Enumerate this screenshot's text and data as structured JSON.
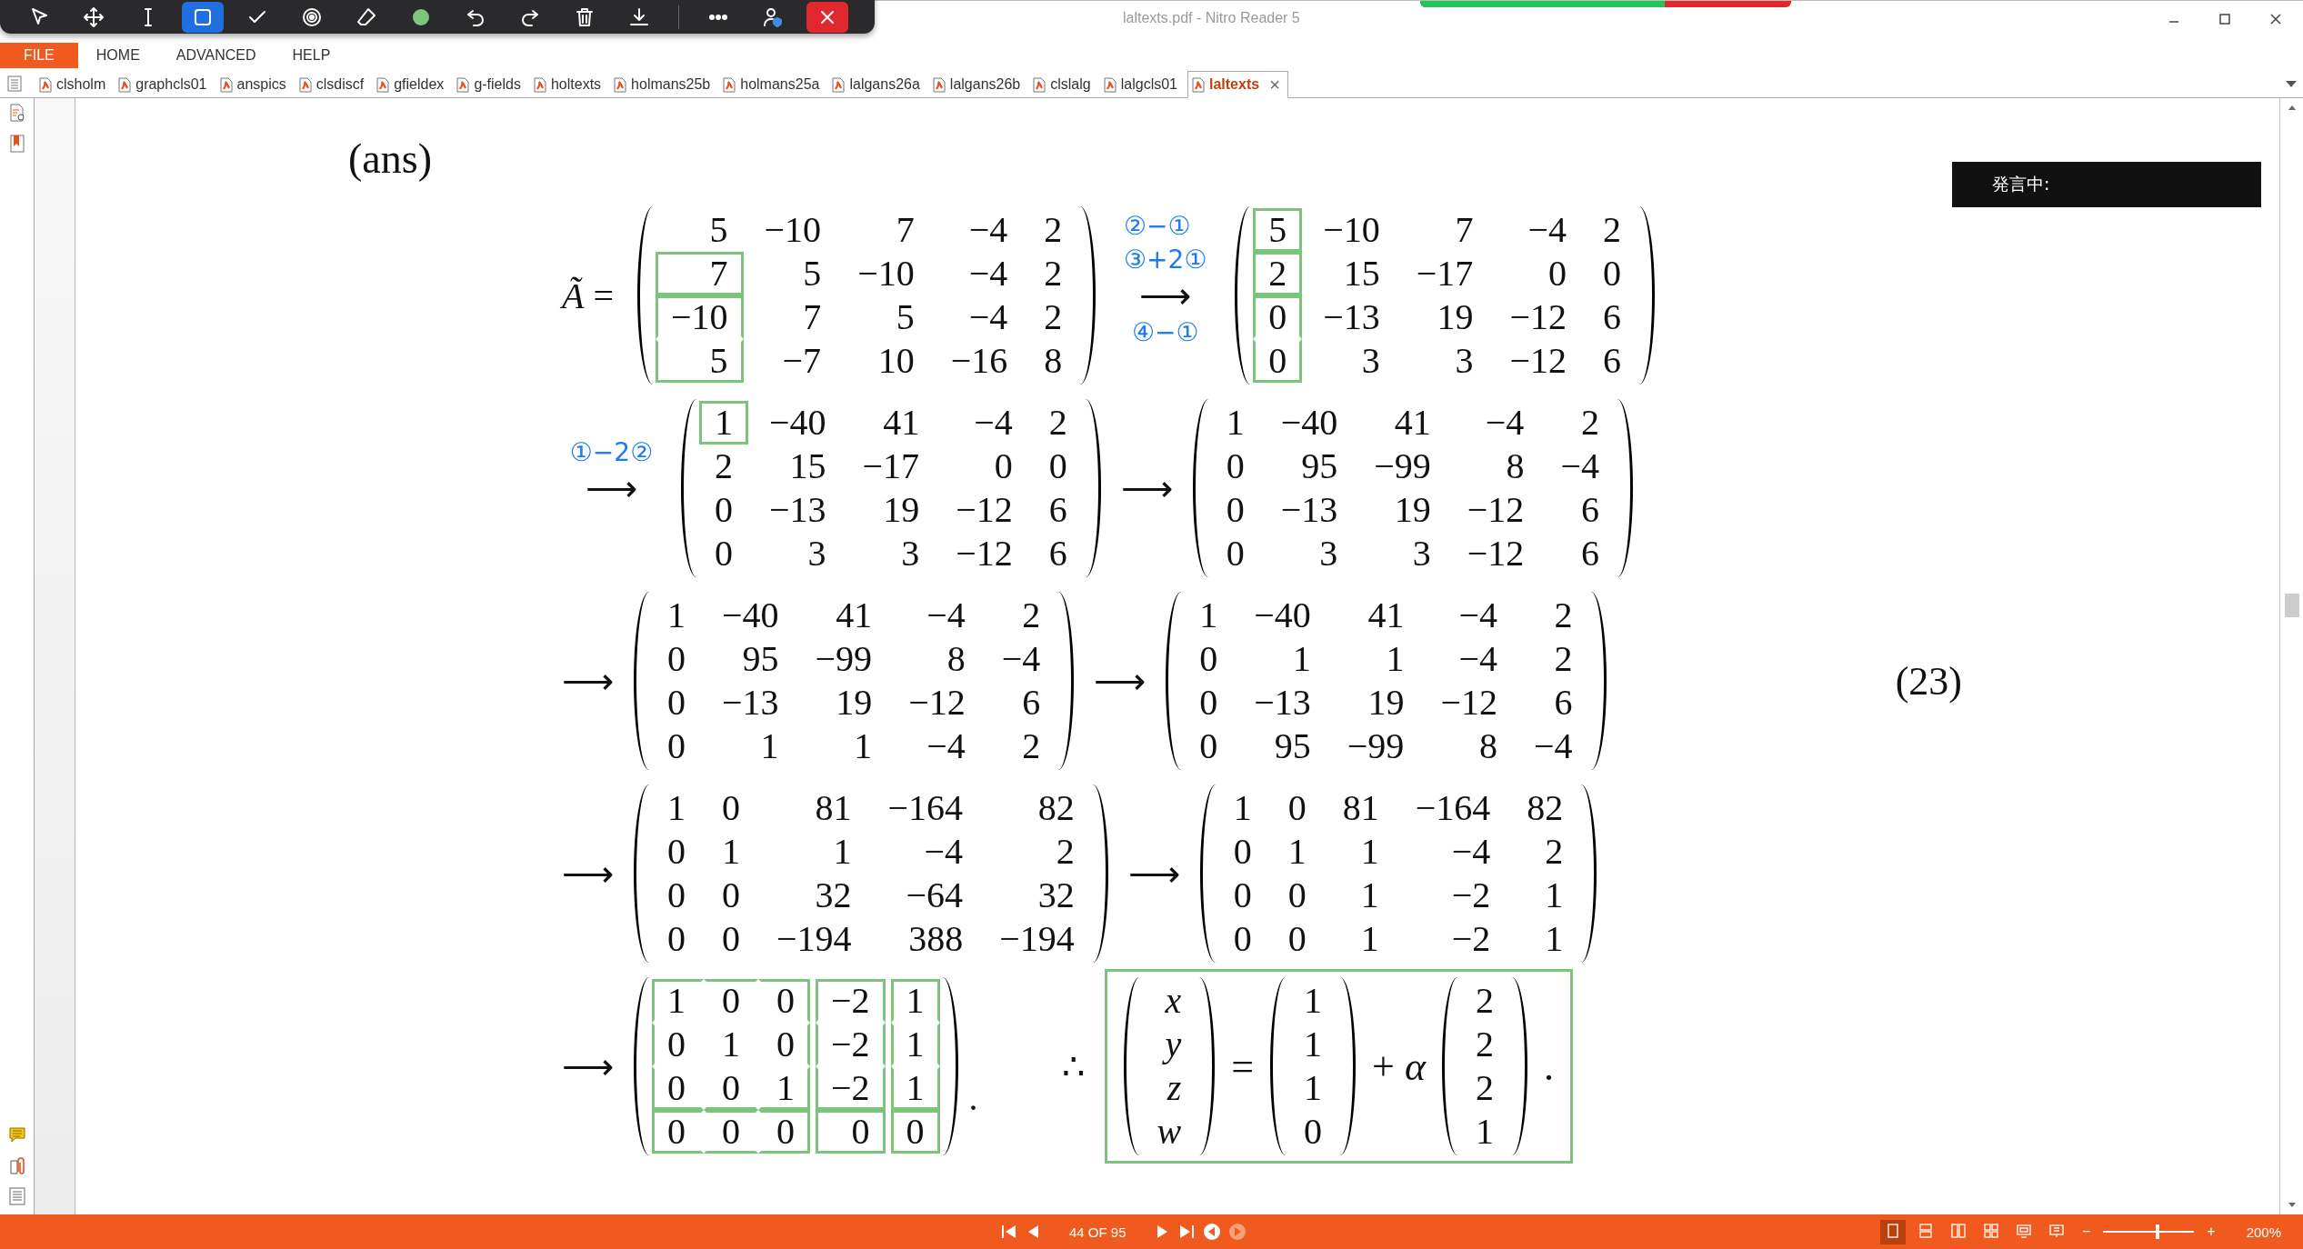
{
  "window": {
    "title": "laltexts.pdf - Nitro Reader 5"
  },
  "meter": {
    "level": 0.66
  },
  "toolbar": [
    {
      "kind": "pointer",
      "selected": false
    },
    {
      "kind": "move",
      "selected": false
    },
    {
      "kind": "text",
      "selected": false
    },
    {
      "kind": "rectangle",
      "selected": true
    },
    {
      "kind": "check",
      "selected": false
    },
    {
      "kind": "record",
      "selected": false
    },
    {
      "kind": "eraser",
      "selected": false
    },
    {
      "kind": "color",
      "selected": false
    },
    {
      "kind": "undo",
      "selected": false
    },
    {
      "kind": "redo",
      "selected": false
    },
    {
      "kind": "delete",
      "selected": false
    },
    {
      "kind": "download",
      "selected": false
    },
    {
      "kind": "more",
      "selected": false
    },
    {
      "kind": "user",
      "selected": false
    },
    {
      "kind": "close",
      "selected": false
    }
  ],
  "menu": [
    {
      "label": "FILE",
      "selected": true
    },
    {
      "label": "HOME",
      "selected": false
    },
    {
      "label": "ADVANCED",
      "selected": false
    },
    {
      "label": "HELP",
      "selected": false
    }
  ],
  "tabs": [
    {
      "label": "clsholm",
      "selected": false
    },
    {
      "label": "graphcls01",
      "selected": false
    },
    {
      "label": "anspics",
      "selected": false
    },
    {
      "label": "clsdiscf",
      "selected": false
    },
    {
      "label": "gfieldex",
      "selected": false
    },
    {
      "label": "g-fields",
      "selected": false
    },
    {
      "label": "holtexts",
      "selected": false
    },
    {
      "label": "holmans25b",
      "selected": false
    },
    {
      "label": "holmans25a",
      "selected": false
    },
    {
      "label": "lalgans26a",
      "selected": false
    },
    {
      "label": "lalgans26b",
      "selected": false
    },
    {
      "label": "clslalg",
      "selected": false
    },
    {
      "label": "lalgcls01",
      "selected": false
    },
    {
      "label": "laltexts",
      "selected": true,
      "close": "×"
    }
  ],
  "popup": {
    "text": "発言中:"
  },
  "document": {
    "heading": "(ans)",
    "rows": [
      {
        "items": [
          {
            "kind": "label",
            "text": "*Ã* ="
          },
          {
            "kind": "matrix",
            "rows": [
              [
                "5",
                "−10",
                "7",
                "−4",
                "2"
              ],
              [
                {
                  "t": "7",
                  "boxed": true
                },
                "5",
                "−10",
                "−4",
                "2"
              ],
              [
                {
                  "t": "−10",
                  "boxed": true,
                  "merge_down": true
                },
                "7",
                "5",
                "−4",
                "2"
              ],
              [
                {
                  "t": "5",
                  "boxed": true
                },
                "−7",
                "10",
                "−16",
                "8"
              ]
            ]
          },
          {
            "kind": "arrow",
            "text": "⟶",
            "notes_above": [
              "②−①",
              "③+2①"
            ],
            "notes_below": [
              "④−①"
            ]
          },
          {
            "kind": "matrix",
            "rows": [
              [
                {
                  "t": "5",
                  "boxed": true
                },
                "−10",
                "7",
                "−4",
                "2"
              ],
              [
                {
                  "t": "2",
                  "boxed": true
                },
                "15",
                "−17",
                "0",
                "0"
              ],
              [
                {
                  "t": "0",
                  "boxed": true,
                  "merge_down": true
                },
                "−13",
                "19",
                "−12",
                "6"
              ],
              [
                {
                  "t": "0",
                  "boxed": true
                },
                "3",
                "3",
                "−12",
                "6"
              ]
            ]
          }
        ]
      },
      {
        "items": [
          {
            "kind": "arrow",
            "text": "⟶",
            "notes_above": [
              "①−2②"
            ]
          },
          {
            "kind": "matrix",
            "rows": [
              [
                {
                  "t": "1",
                  "boxed": true
                },
                "−40",
                "41",
                "−4",
                "2"
              ],
              [
                "2",
                "15",
                "−17",
                "0",
                "0"
              ],
              [
                "0",
                "−13",
                "19",
                "−12",
                "6"
              ],
              [
                "0",
                "3",
                "3",
                "−12",
                "6"
              ]
            ]
          },
          {
            "kind": "arrow",
            "text": "⟶"
          },
          {
            "kind": "matrix",
            "rows": [
              [
                "1",
                "−40",
                "41",
                "−4",
                "2"
              ],
              [
                "0",
                "95",
                "−99",
                "8",
                "−4"
              ],
              [
                "0",
                "−13",
                "19",
                "−12",
                "6"
              ],
              [
                "0",
                "3",
                "3",
                "−12",
                "6"
              ]
            ]
          }
        ]
      },
      {
        "items": [
          {
            "kind": "arrow",
            "text": "⟶"
          },
          {
            "kind": "matrix",
            "rows": [
              [
                "1",
                "−40",
                "41",
                "−4",
                "2"
              ],
              [
                "0",
                "95",
                "−99",
                "8",
                "−4"
              ],
              [
                "0",
                "−13",
                "19",
                "−12",
                "6"
              ],
              [
                "0",
                "1",
                "1",
                "−4",
                "2"
              ]
            ]
          },
          {
            "kind": "arrow",
            "text": "⟶"
          },
          {
            "kind": "matrix",
            "rows": [
              [
                "1",
                "−40",
                "41",
                "−4",
                "2"
              ],
              [
                "0",
                "1",
                "1",
                "−4",
                "2"
              ],
              [
                "0",
                "−13",
                "19",
                "−12",
                "6"
              ],
              [
                "0",
                "95",
                "−99",
                "8",
                "−4"
              ]
            ]
          },
          {
            "kind": "tag",
            "text": "(23)"
          }
        ]
      },
      {
        "items": [
          {
            "kind": "arrow",
            "text": "⟶"
          },
          {
            "kind": "matrix",
            "rows": [
              [
                "1",
                "0",
                "81",
                "−164",
                "82"
              ],
              [
                "0",
                "1",
                "1",
                "−4",
                "2"
              ],
              [
                "0",
                "0",
                "32",
                "−64",
                "32"
              ],
              [
                "0",
                "0",
                "−194",
                "388",
                "−194"
              ]
            ]
          },
          {
            "kind": "arrow",
            "text": "⟶"
          },
          {
            "kind": "matrix",
            "rows": [
              [
                "1",
                "0",
                "81",
                "−164",
                "82"
              ],
              [
                "0",
                "1",
                "1",
                "−4",
                "2"
              ],
              [
                "0",
                "0",
                "1",
                "−2",
                "1"
              ],
              [
                "0",
                "0",
                "1",
                "−2",
                "1"
              ]
            ]
          }
        ]
      },
      {
        "items": [
          {
            "kind": "arrow",
            "text": "⟶"
          },
          {
            "kind": "matrix",
            "rows": [
              [
                {
                  "t": "1",
                  "boxed": true,
                  "merge_down": true,
                  "merge_right": true
                },
                {
                  "t": "0",
                  "boxed": true,
                  "merge_down": true,
                  "merge_right": true
                },
                {
                  "t": "0",
                  "boxed": true,
                  "merge_down": true
                },
                {
                  "t": "−2",
                  "boxed": true,
                  "merge_down": true
                },
                {
                  "t": "1",
                  "boxed": true,
                  "merge_down": true
                }
              ],
              [
                {
                  "t": "0",
                  "boxed": true,
                  "merge_down": true,
                  "merge_right": true
                },
                {
                  "t": "1",
                  "boxed": true,
                  "merge_down": true,
                  "merge_right": true
                },
                {
                  "t": "0",
                  "boxed": true,
                  "merge_down": true
                },
                {
                  "t": "−2",
                  "boxed": true,
                  "merge_down": true
                },
                {
                  "t": "1",
                  "boxed": true,
                  "merge_down": true
                }
              ],
              [
                {
                  "t": "0",
                  "boxed": true,
                  "merge_right": true
                },
                {
                  "t": "0",
                  "boxed": true,
                  "merge_right": true
                },
                {
                  "t": "1",
                  "boxed": true
                },
                {
                  "t": "−2",
                  "boxed": true
                },
                {
                  "t": "1",
                  "boxed": true
                }
              ],
              [
                {
                  "t": "0",
                  "boxed": true,
                  "merge_right": true
                },
                {
                  "t": "0",
                  "boxed": true,
                  "merge_right": true
                },
                {
                  "t": "0",
                  "boxed": true
                },
                {
                  "t": "0",
                  "boxed": true
                },
                {
                  "t": "0",
                  "boxed": true
                }
              ]
            ]
          },
          {
            "kind": "punct",
            "text": "."
          },
          {
            "kind": "therefore",
            "text": "∴"
          },
          {
            "kind": "boxed",
            "items": [
              {
                "kind": "matrix",
                "rows": [
                  [
                    "*x*"
                  ],
                  [
                    "*y*"
                  ],
                  [
                    "*z*"
                  ],
                  [
                    "*w*"
                  ]
                ]
              },
              {
                "kind": "op",
                "text": "="
              },
              {
                "kind": "matrix",
                "rows": [
                  [
                    "1"
                  ],
                  [
                    "1"
                  ],
                  [
                    "1"
                  ],
                  [
                    "0"
                  ]
                ]
              },
              {
                "kind": "op",
                "text": "+ *α*"
              },
              {
                "kind": "matrix",
                "rows": [
                  [
                    "2"
                  ],
                  [
                    "2"
                  ],
                  [
                    "2"
                  ],
                  [
                    "1"
                  ]
                ]
              },
              {
                "kind": "op",
                "text": "."
              }
            ]
          }
        ]
      }
    ]
  },
  "status_bar": {
    "page": "44 OF 95",
    "zoom": "200%",
    "zoom_slider": {
      "level": 0.6
    },
    "view_modes": [
      {
        "kind": "single",
        "selected": true
      },
      {
        "kind": "continuous",
        "selected": false
      },
      {
        "kind": "facing",
        "selected": false
      },
      {
        "kind": "facing-continuous",
        "selected": false
      },
      {
        "kind": "fullscreen",
        "selected": false
      },
      {
        "kind": "presentation",
        "selected": false
      }
    ],
    "zoom_out": "−",
    "zoom_in": "+"
  }
}
